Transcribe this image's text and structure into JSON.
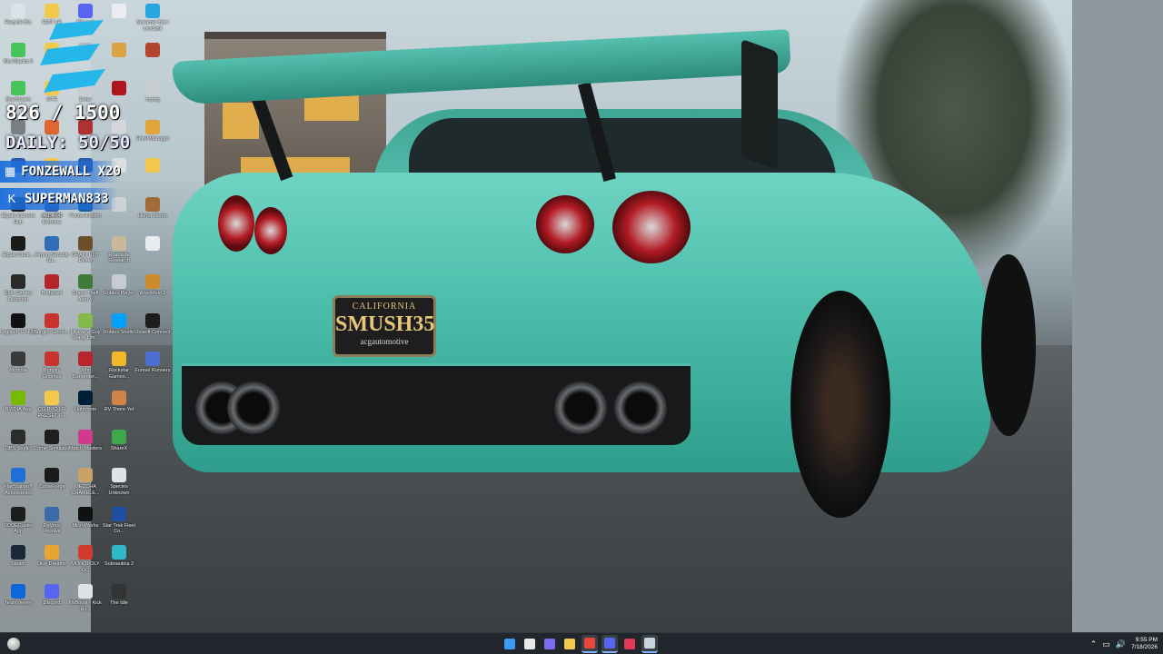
{
  "overlay": {
    "count": "826 / 1500",
    "daily": "DAILY: 50/50",
    "gifts": [
      {
        "text": "FONZEWALL X20"
      },
      {
        "text": "SUPERMAN833"
      }
    ]
  },
  "plate": {
    "state": "CALIFORNIA",
    "number": "SMUSH35",
    "dealer": "acgautomotive"
  },
  "icons": [
    {
      "label": "Recycle Bin",
      "icon": "recycle-bin-icon",
      "color": "#d9e3ea"
    },
    {
      "label": "EDIT LR",
      "icon": "folder-icon",
      "color": "#f2c94c"
    },
    {
      "label": "Discord",
      "icon": "discord-icon",
      "color": "#5865f2"
    },
    {
      "label": "",
      "icon": "document-icon",
      "color": "#e9edf0"
    },
    {
      "label": "Streamer Bot / LiveSplit",
      "icon": "streamer-bot-icon",
      "color": "#2aa7e0"
    },
    {
      "label": "BlueStacks 5",
      "icon": "bluestacks-icon",
      "color": "#47c35a"
    },
    {
      "label": "",
      "icon": "folder-icon",
      "color": "#f2c94c"
    },
    {
      "label": "",
      "icon": "app-icon",
      "color": "#b0b7bd"
    },
    {
      "label": "",
      "icon": "app-icon",
      "color": "#d9a441"
    },
    {
      "label": "",
      "icon": "app-icon",
      "color": "#b2452f"
    },
    {
      "label": "BlueStacks",
      "icon": "bluestacks-icon",
      "color": "#47c35a"
    },
    {
      "label": "GTR",
      "icon": "folder-icon",
      "color": "#f2c94c"
    },
    {
      "label": "Enter",
      "icon": "app-icon",
      "color": "#c8ccd0"
    },
    {
      "label": "",
      "icon": "app-icon",
      "color": "#b0151d"
    },
    {
      "label": "m.png",
      "icon": "image-file-icon",
      "color": "#c9ced2"
    },
    {
      "label": "Cash",
      "icon": "app-icon",
      "color": "#7a7f83"
    },
    {
      "label": "",
      "icon": "app-icon",
      "color": "#e16530"
    },
    {
      "label": "",
      "icon": "app-icon",
      "color": "#b03131"
    },
    {
      "label": "",
      "icon": "app-icon",
      "color": "#d4d7da"
    },
    {
      "label": "Hotel Manager",
      "icon": "app-icon",
      "color": "#e0a43a"
    },
    {
      "label": "",
      "icon": "app-icon",
      "color": "#2b5aa8"
    },
    {
      "label": "",
      "icon": "app-icon",
      "color": "#f2c94c"
    },
    {
      "label": "",
      "icon": "app-icon",
      "color": "#2b5aa8"
    },
    {
      "label": "",
      "icon": "app-icon",
      "color": "#dcdfe2"
    },
    {
      "label": "",
      "icon": "folder-icon",
      "color": "#f2c94c"
    },
    {
      "label": "drop.JPG",
      "icon": "image-file-icon",
      "color": "#7b8c95"
    },
    {
      "label": "",
      "icon": "app-icon",
      "color": "#c9ced2"
    },
    {
      "label": "Elgato Camera Hub",
      "icon": "elgato-icon",
      "color": "#1b1b1b"
    },
    {
      "label": "AIDA64 Extreme",
      "icon": "aida64-icon",
      "color": "#2e5fb1"
    },
    {
      "label": "Forza Horizon",
      "icon": "forza-icon",
      "color": "#1b5fa3"
    },
    {
      "label": "",
      "icon": "app-icon",
      "color": "#cfd3d6"
    },
    {
      "label": "Horror Demo",
      "icon": "app-icon",
      "color": "#a06b38"
    },
    {
      "label": "Elgato Contr...",
      "icon": "elgato-icon",
      "color": "#1b1b1b"
    },
    {
      "label": "Airport Security Su...",
      "icon": "app-icon",
      "color": "#2f6db5"
    },
    {
      "label": "GRAIN ROT Demo",
      "icon": "app-icon",
      "color": "#6e4f2c"
    },
    {
      "label": "Roadside Research",
      "icon": "app-icon",
      "color": "#c9b89a"
    },
    {
      "label": "",
      "icon": "app-icon",
      "color": "#e8ecef"
    },
    {
      "label": "Epic Games Launcher",
      "icon": "epic-games-icon",
      "color": "#2a2a2a"
    },
    {
      "label": "Bodycam",
      "icon": "bodycam-icon",
      "color": "#b5262b"
    },
    {
      "label": "Grand Theft Auto V",
      "icon": "gta-icon",
      "color": "#3f7a3b"
    },
    {
      "label": "Roblox Player",
      "icon": "roblox-icon",
      "color": "#c7ccd1"
    },
    {
      "label": "Wreckfest 2",
      "icon": "app-icon",
      "color": "#c98b2c"
    },
    {
      "label": "Logitech G HUB",
      "icon": "logitech-icon",
      "color": "#111"
    },
    {
      "label": "Burglin' Gnom...",
      "icon": "app-icon",
      "color": "#c8332e"
    },
    {
      "label": "I Know a Guy Shady Life...",
      "icon": "app-icon",
      "color": "#85b84a"
    },
    {
      "label": "Roblox Studio",
      "icon": "roblox-studio-icon",
      "color": "#00a2ff"
    },
    {
      "label": "Ubisoft Connect",
      "icon": "ubisoft-icon",
      "color": "#1d1d1d"
    },
    {
      "label": "Mumble",
      "icon": "mumble-icon",
      "color": "#3a3a3a"
    },
    {
      "label": "Burglin' Gnomes",
      "icon": "app-icon",
      "color": "#c8332e"
    },
    {
      "label": "John Carpenter...",
      "icon": "app-icon",
      "color": "#b8252c"
    },
    {
      "label": "Rockstar Games...",
      "icon": "rockstar-icon",
      "color": "#f3b829"
    },
    {
      "label": "Funnel Runners",
      "icon": "app-icon",
      "color": "#4c6fd0"
    },
    {
      "label": "NVIDIA App",
      "icon": "nvidia-icon",
      "color": "#76b900"
    },
    {
      "label": "CG PRO LR PRESET P...",
      "icon": "folder-icon",
      "color": "#f2c94c"
    },
    {
      "label": "Lightroom",
      "icon": "lightroom-icon",
      "color": "#001e36"
    },
    {
      "label": "RV There Yet",
      "icon": "app-icon",
      "color": "#d1844a"
    },
    {
      "label": "OBS Studio",
      "icon": "obs-icon",
      "color": "#2c2c2c"
    },
    {
      "label": "Crime Simulator",
      "icon": "app-icon",
      "color": "#1e1e1e"
    },
    {
      "label": "Match Masters",
      "icon": "app-icon",
      "color": "#d13a8c"
    },
    {
      "label": "ShareX",
      "icon": "sharex-icon",
      "color": "#3fa84a"
    },
    {
      "label": "PlayStation® Accessories",
      "icon": "playstation-icon",
      "color": "#1f6fd6"
    },
    {
      "label": "CurseForge",
      "icon": "curseforge-icon",
      "color": "#1b1b1b"
    },
    {
      "label": "MECCHA CHAMELE...",
      "icon": "app-icon",
      "color": "#c9a26a"
    },
    {
      "label": "Species Unknown",
      "icon": "app-icon",
      "color": "#dfe3e6"
    },
    {
      "label": "RODECaster App",
      "icon": "rodecaster-icon",
      "color": "#1d1d1d"
    },
    {
      "label": "DaVinci Resolve",
      "icon": "davinci-icon",
      "color": "#3a6aa8"
    },
    {
      "label": "MicroWorks",
      "icon": "app-icon",
      "color": "#111"
    },
    {
      "label": "Star Trek Fleet Co...",
      "icon": "app-icon",
      "color": "#1e4fa3"
    },
    {
      "label": "Steam",
      "icon": "steam-icon",
      "color": "#1b2838"
    },
    {
      "label": "Dice Dreams",
      "icon": "app-icon",
      "color": "#e7a531"
    },
    {
      "label": "MONOPOLY GO",
      "icon": "app-icon",
      "color": "#d23b2f"
    },
    {
      "label": "Subnautica 2",
      "icon": "app-icon",
      "color": "#2fb6c9"
    },
    {
      "label": "TeamViewer",
      "icon": "teamviewer-icon",
      "color": "#0e67d9"
    },
    {
      "label": "Discord",
      "icon": "discord-icon",
      "color": "#5865f2"
    },
    {
      "label": "MrBoost - Kick Hy...",
      "icon": "app-icon",
      "color": "#e0e3e6"
    },
    {
      "label": "The Idle",
      "icon": "app-icon",
      "color": "#333"
    }
  ],
  "taskbar": {
    "apps": [
      {
        "name": "start-button",
        "color": "#3a9bf0",
        "active": false
      },
      {
        "name": "search-button",
        "color": "#e8e8e8",
        "active": false
      },
      {
        "name": "copilot-button",
        "color": "#7a6cf0",
        "active": false
      },
      {
        "name": "file-explorer-button",
        "color": "#f2c94c",
        "active": false
      },
      {
        "name": "chrome-button",
        "color": "#e8453c",
        "active": true
      },
      {
        "name": "discord-button",
        "color": "#5865f2",
        "active": true
      },
      {
        "name": "adobe-button",
        "color": "#e03a5a",
        "active": false
      },
      {
        "name": "steam-button",
        "color": "#c6d4df",
        "active": true
      }
    ],
    "time": "9:55 PM",
    "date": "7/18/2026"
  }
}
